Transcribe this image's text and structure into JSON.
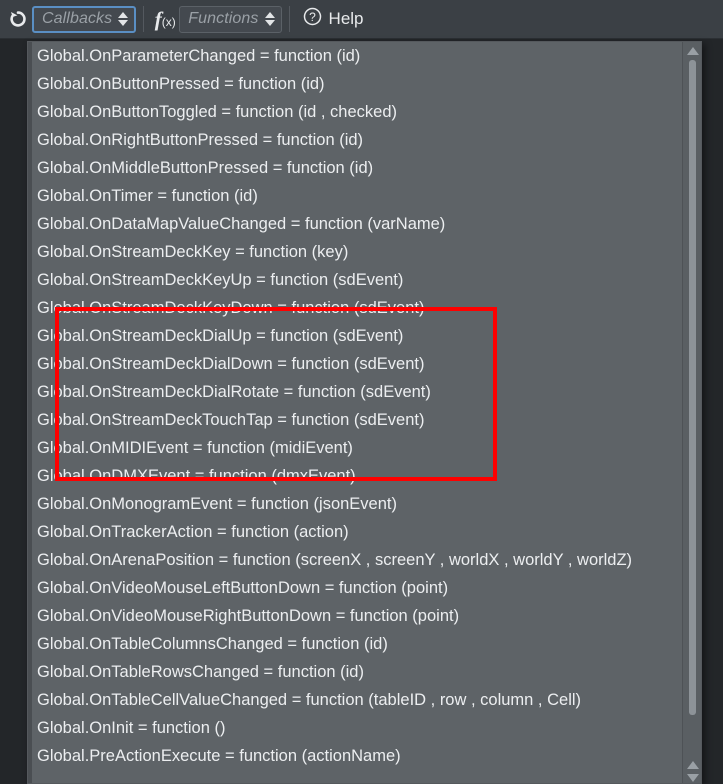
{
  "toolbar": {
    "refresh_icon": "refresh-circular-arrow-icon",
    "callbacks_combo": {
      "placeholder": "Callbacks",
      "value": ""
    },
    "functions_icon": "fx-function-icon",
    "fx_label": "f",
    "fx_sub": "(x)",
    "functions_combo": {
      "placeholder": "Functions",
      "value": ""
    },
    "help_icon": "question-mark-circle-icon",
    "help_label": "Help"
  },
  "dropdown": {
    "options": [
      {
        "text": "Global.OnParameterChanged = function (id)",
        "highlighted": false
      },
      {
        "text": "Global.OnButtonPressed = function (id)",
        "highlighted": false
      },
      {
        "text": "Global.OnButtonToggled = function (id , checked)",
        "highlighted": false
      },
      {
        "text": "Global.OnRightButtonPressed = function (id)",
        "highlighted": false
      },
      {
        "text": "Global.OnMiddleButtonPressed = function (id)",
        "highlighted": false
      },
      {
        "text": "Global.OnTimer = function (id)",
        "highlighted": false
      },
      {
        "text": "Global.OnDataMapValueChanged = function (varName)",
        "highlighted": false
      },
      {
        "text": "Global.OnStreamDeckKey = function (key)",
        "highlighted": false
      },
      {
        "text": "Global.OnStreamDeckKeyUp = function (sdEvent)",
        "highlighted": true
      },
      {
        "text": "Global.OnStreamDeckKeyDown = function (sdEvent)",
        "highlighted": true
      },
      {
        "text": "Global.OnStreamDeckDialUp = function (sdEvent)",
        "highlighted": true
      },
      {
        "text": "Global.OnStreamDeckDialDown = function (sdEvent)",
        "highlighted": true
      },
      {
        "text": "Global.OnStreamDeckDialRotate = function (sdEvent)",
        "highlighted": true
      },
      {
        "text": "Global.OnStreamDeckTouchTap = function (sdEvent)",
        "highlighted": true
      },
      {
        "text": "Global.OnMIDIEvent = function (midiEvent)",
        "highlighted": false
      },
      {
        "text": "Global.OnDMXEvent = function (dmxEvent)",
        "highlighted": false
      },
      {
        "text": "Global.OnMonogramEvent = function (jsonEvent)",
        "highlighted": false
      },
      {
        "text": "Global.OnTrackerAction = function (action)",
        "highlighted": false
      },
      {
        "text": "Global.OnArenaPosition = function (screenX , screenY , worldX , worldY , worldZ)",
        "highlighted": false
      },
      {
        "text": "Global.OnVideoMouseLeftButtonDown = function (point)",
        "highlighted": false
      },
      {
        "text": "Global.OnVideoMouseRightButtonDown = function (point)",
        "highlighted": false
      },
      {
        "text": "Global.OnTableColumnsChanged = function (id)",
        "highlighted": false
      },
      {
        "text": "Global.OnTableRowsChanged = function (id)",
        "highlighted": false
      },
      {
        "text": "Global.OnTableCellValueChanged = function (tableID , row , column , Cell)",
        "highlighted": false
      },
      {
        "text": "Global.OnInit = function ()",
        "highlighted": false
      },
      {
        "text": "Global.PreActionExecute = function (actionName)",
        "highlighted": false
      }
    ]
  },
  "scrollbar": {
    "up_arrow_icon": "scroll-up-arrow-icon",
    "down_arrow_icon": "scroll-down-arrow-icon"
  },
  "annotation": {
    "highlight_color": "#ff0000",
    "label": "streamdeck-callbacks-highlight"
  }
}
